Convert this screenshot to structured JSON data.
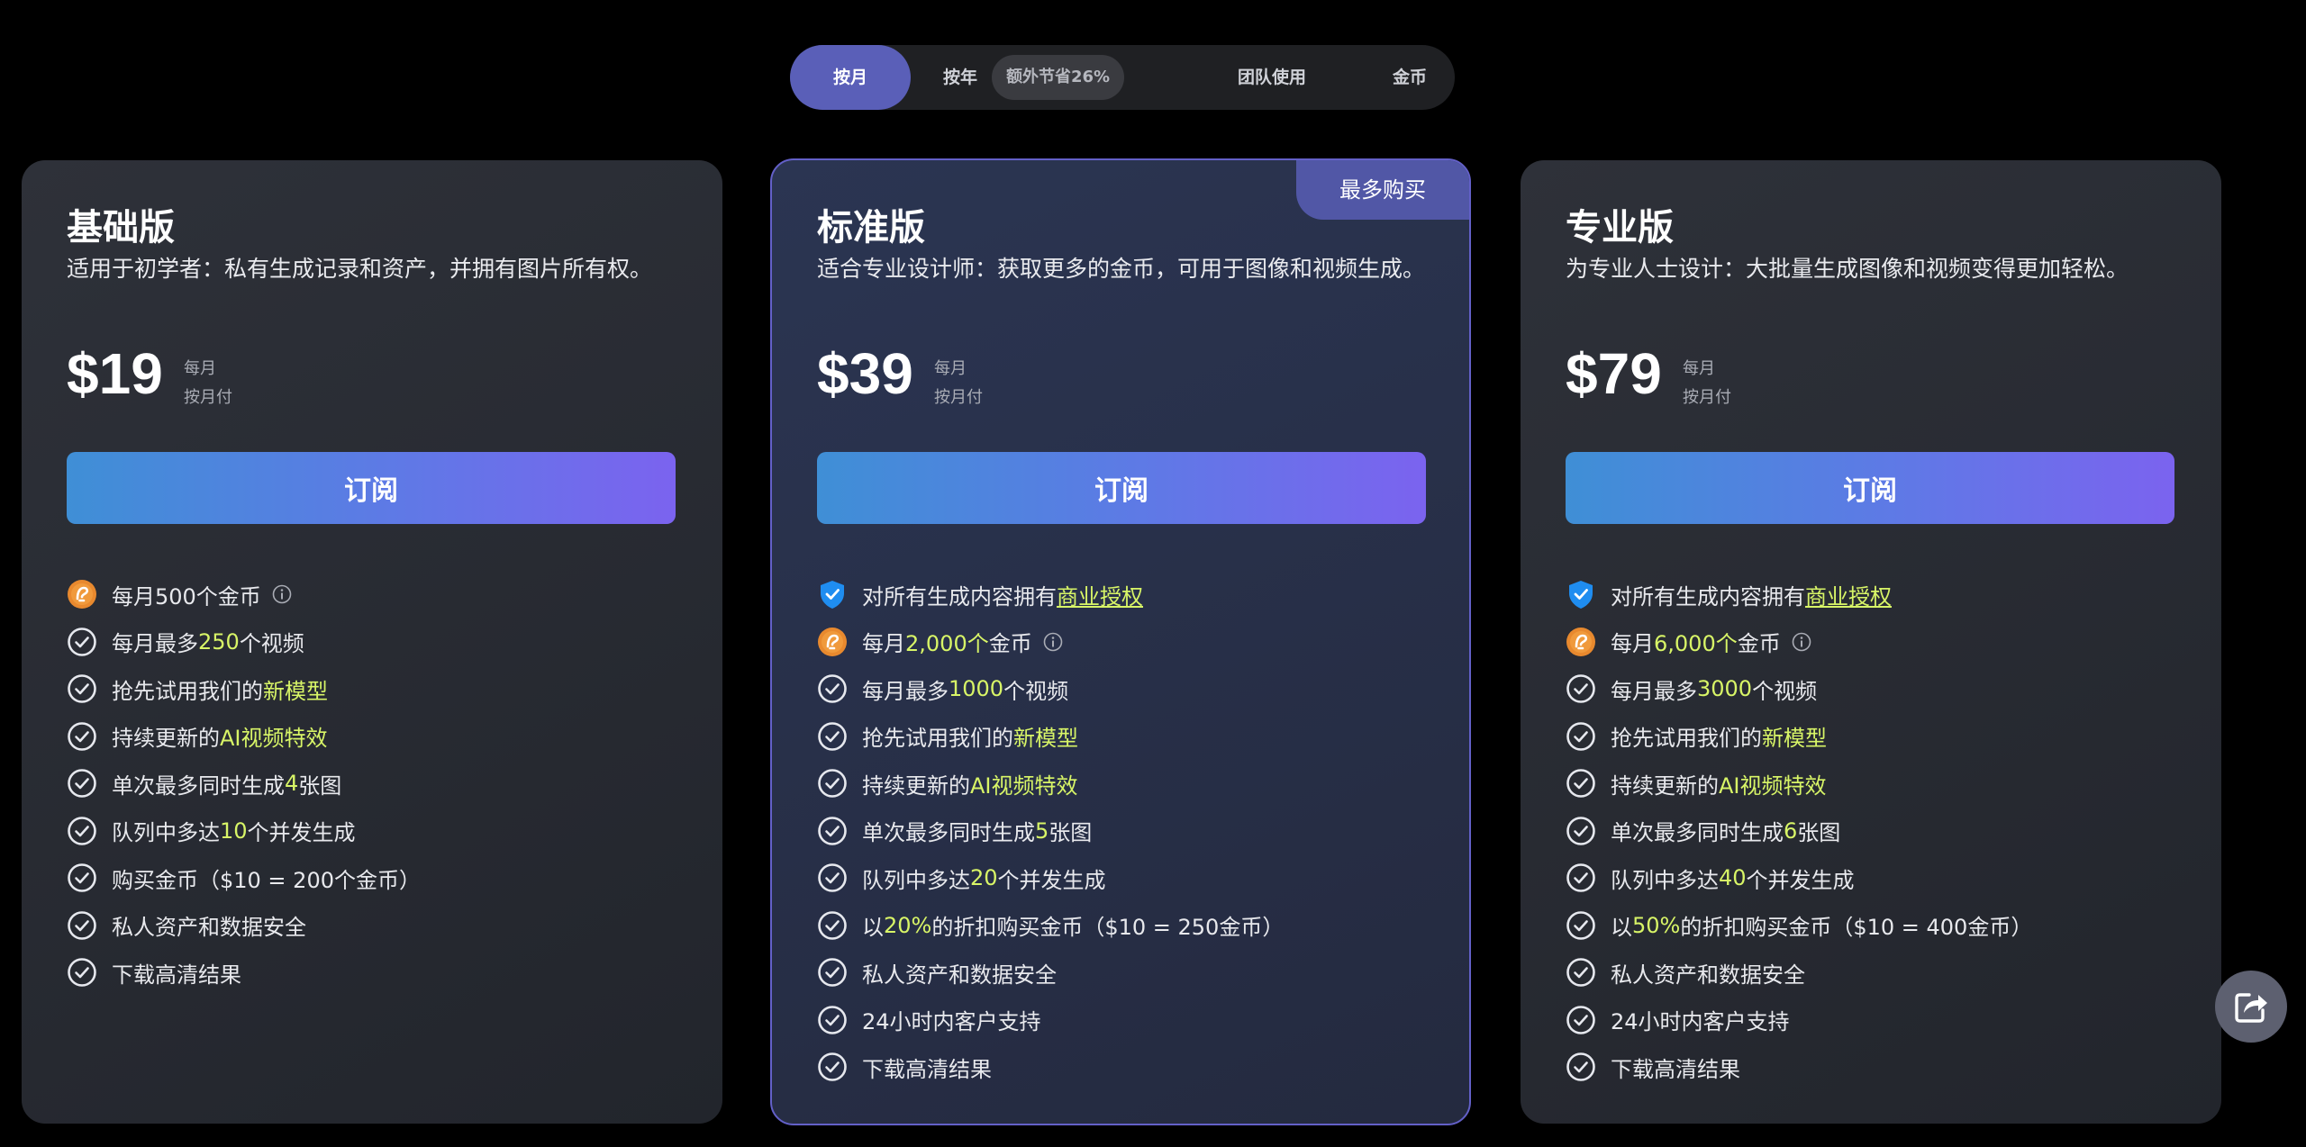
{
  "tabs": {
    "monthly": "按月",
    "yearly": "按年",
    "yearly_badge": "额外节省26%",
    "team": "团队使用",
    "coins": "金币"
  },
  "colors": {
    "accent": "#5a5fb8",
    "highlight": "#d8f567",
    "badge": "#5157a6"
  },
  "icons": {
    "check": "check-circle-icon",
    "coin": "coin-icon",
    "shield": "shield-check-icon",
    "info": "info-icon",
    "share": "share-icon"
  },
  "plans": [
    {
      "name": "基础版",
      "desc": "适用于初学者：私有生成记录和资产，并拥有图片所有权。",
      "price": "$19",
      "period1": "每月",
      "period2": "按月付",
      "cta": "订阅",
      "features": {
        "coins_text": "每月500个金币",
        "videos_pre": "每月最多 ",
        "videos_num": "250",
        "videos_post": " 个视频",
        "models_pre": "抢先试用我们的 ",
        "models_hl": "新模型",
        "effects_pre": "持续更新的 ",
        "effects_hl": "AI视频特效",
        "gen_pre": "单次最多同时生成",
        "gen_num": "4",
        "gen_post": "张图",
        "queue_pre": "队列中多达",
        "queue_num": "10",
        "queue_post": "个并发生成",
        "buy": "购买金币（$10 = 200个金币）",
        "privacy": "私人资产和数据安全",
        "download": "下载高清结果"
      }
    },
    {
      "name": "标准版",
      "badge": "最多购买",
      "desc": "适合专业设计师：获取更多的金币，可用于图像和视频生成。",
      "price": "$39",
      "period1": "每月",
      "period2": "按月付",
      "cta": "订阅",
      "features": {
        "license_pre": "对所有生成内容拥有",
        "license_link": "商业授权",
        "coins_pre": "每月",
        "coins_num": "2,000个",
        "coins_post": "金币",
        "videos_pre": "每月最多 ",
        "videos_num": "1000",
        "videos_post": " 个视频",
        "models_pre": "抢先试用我们的 ",
        "models_hl": "新模型",
        "effects_pre": "持续更新的 ",
        "effects_hl": "AI视频特效",
        "gen_pre": "单次最多同时生成",
        "gen_num": "5",
        "gen_post": "张图",
        "queue_pre": "队列中多达",
        "queue_num": "20",
        "queue_post": "个并发生成",
        "disc_pre": "以",
        "disc_num": "20%",
        "disc_post": "的折扣购买金币（$10 = 250金币）",
        "privacy": "私人资产和数据安全",
        "support": "24小时内客户支持",
        "download": "下载高清结果"
      }
    },
    {
      "name": "专业版",
      "desc": "为专业人士设计：大批量生成图像和视频变得更加轻松。",
      "price": "$79",
      "period1": "每月",
      "period2": "按月付",
      "cta": "订阅",
      "features": {
        "license_pre": "对所有生成内容拥有",
        "license_link": "商业授权",
        "coins_pre": "每月",
        "coins_num": "6,000个",
        "coins_post": "金币",
        "videos_pre": "每月最多 ",
        "videos_num": "3000",
        "videos_post": " 个视频",
        "models_pre": "抢先试用我们的 ",
        "models_hl": "新模型",
        "effects_pre": "持续更新的 ",
        "effects_hl": "AI视频特效",
        "gen_pre": "单次最多同时生成",
        "gen_num": "6",
        "gen_post": "张图",
        "queue_pre": "队列中多达",
        "queue_num": "40",
        "queue_post": "个并发生成",
        "disc_pre": "以",
        "disc_num": "50%",
        "disc_post": "的折扣购买金币（$10 = 400金币）",
        "privacy": "私人资产和数据安全",
        "support": "24小时内客户支持",
        "download": "下载高清结果"
      }
    }
  ]
}
